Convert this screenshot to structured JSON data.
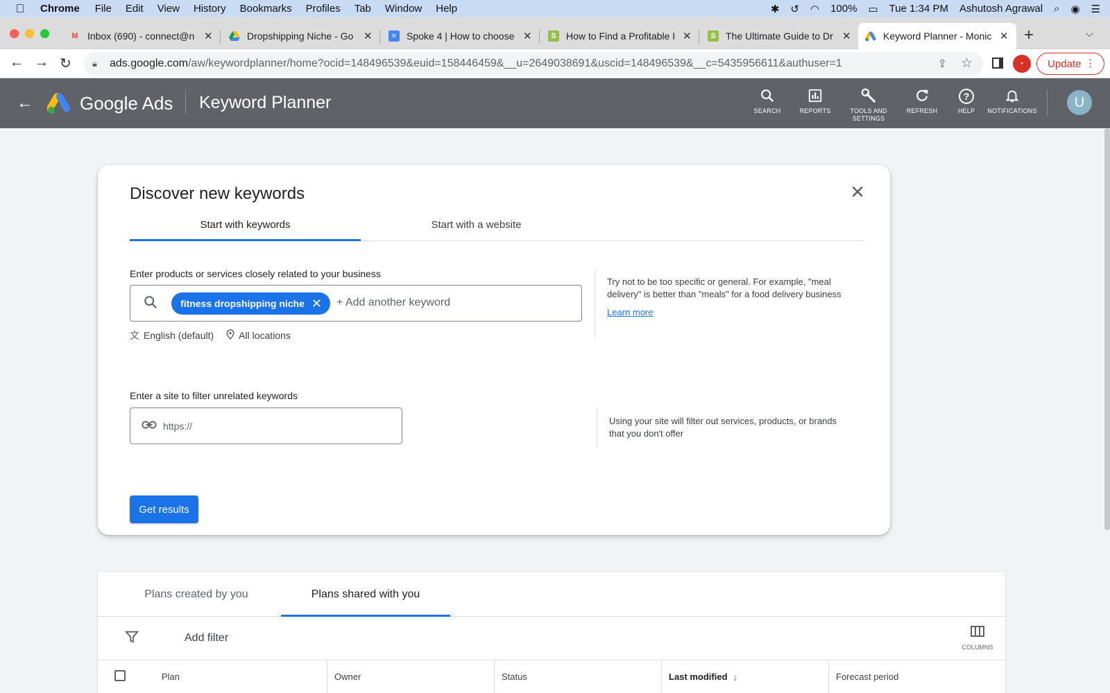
{
  "menubar": {
    "app": "Chrome",
    "items": [
      "File",
      "Edit",
      "View",
      "History",
      "Bookmarks",
      "Profiles",
      "Tab",
      "Window",
      "Help"
    ],
    "battery": "100%",
    "clock": "Tue 1:34 PM",
    "user": "Ashutosh Agrawal"
  },
  "tabs": [
    {
      "title": "Inbox (690) - connect@n",
      "favicon": "gmail-icon"
    },
    {
      "title": "Dropshipping Niche - Go",
      "favicon": "google-drive-icon"
    },
    {
      "title": "Spoke 4 | How to choose",
      "favicon": "google-docs-icon"
    },
    {
      "title": "How to Find a Profitable I",
      "favicon": "shopify-icon"
    },
    {
      "title": "The Ultimate Guide to Dr",
      "favicon": "shopify-icon"
    },
    {
      "title": "Keyword Planner - Monic",
      "favicon": "google-ads-icon",
      "active": true
    }
  ],
  "address": {
    "domain": "ads.google.com",
    "path": "/aw/keywordplanner/home?ocid=148496539&euid=158446459&__u=2649038691&uscid=148496539&__c=5435956611&authuser=1"
  },
  "browser": {
    "update_label": "Update"
  },
  "ads_header": {
    "brand": "Google Ads",
    "product": "Keyword Planner",
    "buttons": [
      {
        "label": "SEARCH",
        "icon": "search-icon"
      },
      {
        "label": "REPORTS",
        "icon": "reports-icon"
      },
      {
        "label": "TOOLS AND SETTINGS",
        "icon": "wrench-icon"
      },
      {
        "label": "REFRESH",
        "icon": "refresh-icon"
      },
      {
        "label": "HELP",
        "icon": "help-icon"
      },
      {
        "label": "NOTIFICATIONS",
        "icon": "bell-icon"
      }
    ],
    "avatar_letter": "U"
  },
  "discover": {
    "title": "Discover new keywords",
    "tabs": [
      "Start with keywords",
      "Start with a website"
    ],
    "keywords_label": "Enter products or services closely related to your business",
    "keyword_chip": "fitness dropshipping niche",
    "add_keyword_placeholder": "+ Add another keyword",
    "language": "English (default)",
    "location": "All locations",
    "hint_keywords": "Try not to be too specific or general. For example, \"meal delivery\" is better than \"meals\" for a food delivery business",
    "learn_more": "Learn more",
    "site_label": "Enter a site to filter unrelated keywords",
    "site_placeholder": "https://",
    "hint_site": "Using your site will filter out services, products, or brands that you don't offer",
    "get_results": "Get results"
  },
  "plans": {
    "tabs": [
      "Plans created by you",
      "Plans shared with you"
    ],
    "add_filter": "Add filter",
    "columns_label": "COLUMNS",
    "headers": [
      "Plan",
      "Owner",
      "Status",
      "Last modified",
      "Forecast period"
    ]
  }
}
